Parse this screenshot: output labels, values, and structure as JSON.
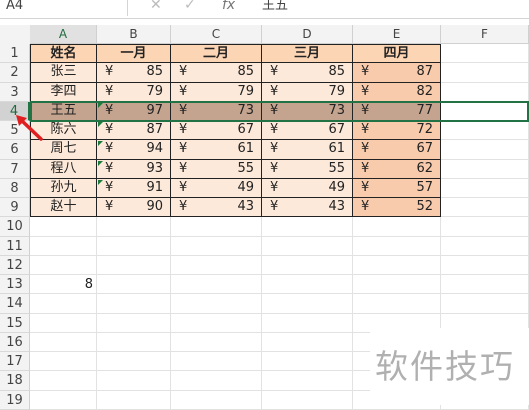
{
  "formula_bar": {
    "name_box": "A4",
    "cancel_icon": "✕",
    "confirm_icon": "✓",
    "fx_label": "fx",
    "formula": "王五"
  },
  "columns": [
    "A",
    "B",
    "C",
    "D",
    "E",
    "F"
  ],
  "row_numbers": [
    "1",
    "2",
    "3",
    "4",
    "5",
    "6",
    "7",
    "8",
    "9",
    "10",
    "11",
    "12",
    "13",
    "14",
    "15",
    "16",
    "17",
    "18",
    "19"
  ],
  "table": {
    "headers": [
      "姓名",
      "一月",
      "二月",
      "三月",
      "四月"
    ],
    "currency": "¥",
    "rows": [
      {
        "name": "张三",
        "values": [
          "85",
          "85",
          "85",
          "87"
        ]
      },
      {
        "name": "李四",
        "values": [
          "79",
          "79",
          "79",
          "82"
        ]
      },
      {
        "name": "王五",
        "values": [
          "97",
          "73",
          "73",
          "77"
        ]
      },
      {
        "name": "陈六",
        "values": [
          "87",
          "67",
          "67",
          "72"
        ]
      },
      {
        "name": "周七",
        "values": [
          "94",
          "61",
          "61",
          "67"
        ]
      },
      {
        "name": "程八",
        "values": [
          "93",
          "55",
          "55",
          "62"
        ]
      },
      {
        "name": "孙九",
        "values": [
          "91",
          "49",
          "49",
          "57"
        ]
      },
      {
        "name": "赵十",
        "values": [
          "90",
          "43",
          "43",
          "52"
        ]
      }
    ]
  },
  "extra_cell": {
    "address": "B13",
    "value": "8"
  },
  "selected_row": "4",
  "watermark": "软件技巧",
  "colors": {
    "header_fill": "#fcd5b4",
    "row_fill_light": "#fde9d9",
    "row_fill_dark": "#f8cbad",
    "selected_fill": "#c4a48f",
    "selection_border": "#217346",
    "arrow": "#e02020"
  }
}
